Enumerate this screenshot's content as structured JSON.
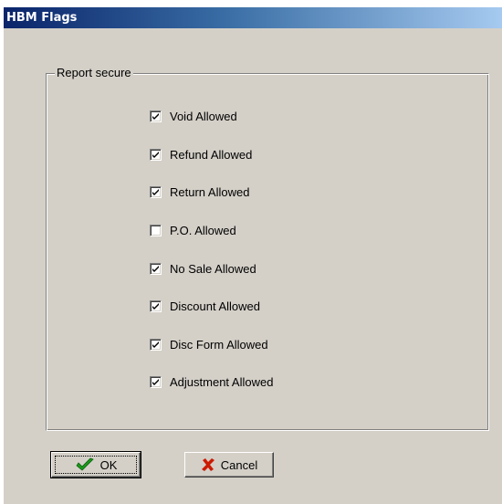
{
  "window": {
    "title": "HBM Flags"
  },
  "group": {
    "label": "Report secure"
  },
  "flags": [
    {
      "label": "Void Allowed",
      "checked": true
    },
    {
      "label": "Refund Allowed",
      "checked": true
    },
    {
      "label": "Return Allowed",
      "checked": true
    },
    {
      "label": "P.O. Allowed",
      "checked": false
    },
    {
      "label": "No Sale Allowed",
      "checked": true
    },
    {
      "label": "Discount Allowed",
      "checked": true
    },
    {
      "label": "Disc Form Allowed",
      "checked": true
    },
    {
      "label": "Adjustment Allowed",
      "checked": true
    }
  ],
  "buttons": {
    "ok": {
      "label": "OK",
      "icon": "checkmark-icon"
    },
    "cancel": {
      "label": "Cancel",
      "icon": "x-icon"
    }
  },
  "colors": {
    "checkmark": "#1a9a1a",
    "cancel_x": "#cc1a00"
  }
}
